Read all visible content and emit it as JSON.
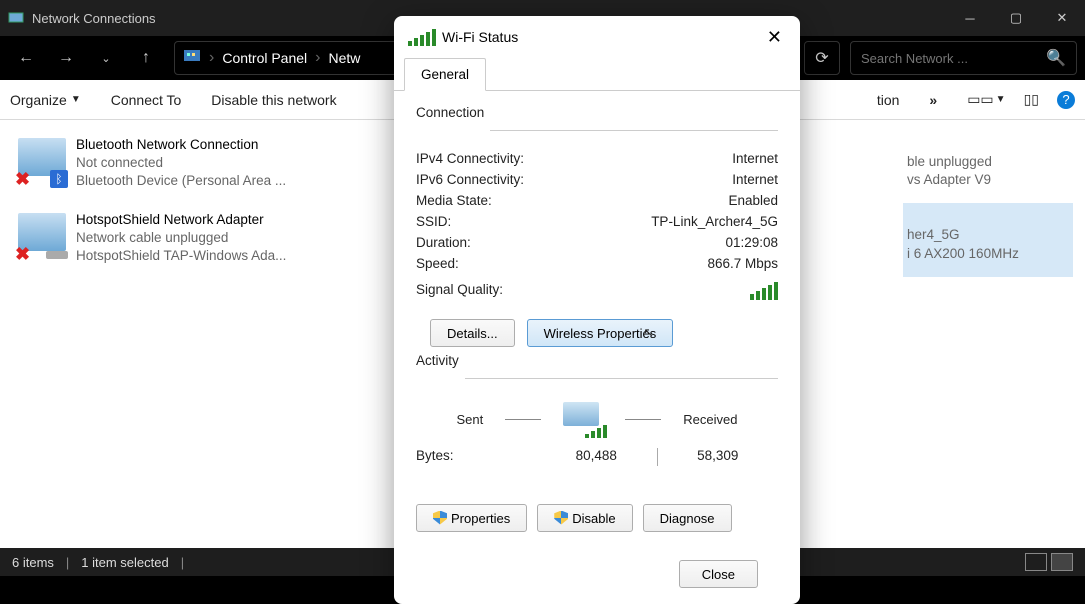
{
  "window": {
    "title": "Network Connections"
  },
  "nav": {
    "crumb1": "Control Panel",
    "crumb2": "Netw",
    "search_placeholder": "Search Network ..."
  },
  "toolbar": {
    "organize": "Organize",
    "connect": "Connect To",
    "disable": "Disable this network",
    "more_trunc": "tion"
  },
  "adapters": [
    {
      "name": "Bluetooth Network Connection",
      "status": "Not connected",
      "device": "Bluetooth Device (Personal Area ..."
    },
    {
      "name": "HotspotShield Network Adapter",
      "status": "Network cable unplugged",
      "device": "HotspotShield TAP-Windows Ada..."
    }
  ],
  "adapters_col2_cut": [
    {
      "status_cut": "ble unplugged",
      "device_cut": "vs Adapter V9"
    },
    {
      "status_cut": "her4_5G",
      "device_cut": "i 6 AX200 160MHz"
    }
  ],
  "statusbar": {
    "count": "6 items",
    "sel": "1 item selected",
    "divider": "|"
  },
  "dialog": {
    "title": "Wi-Fi Status",
    "tab": "General",
    "group_connection": "Connection",
    "ipv4_l": "IPv4 Connectivity:",
    "ipv4_v": "Internet",
    "ipv6_l": "IPv6 Connectivity:",
    "ipv6_v": "Internet",
    "media_l": "Media State:",
    "media_v": "Enabled",
    "ssid_l": "SSID:",
    "ssid_v": "TP-Link_Archer4_5G",
    "dur_l": "Duration:",
    "dur_v": "01:29:08",
    "speed_l": "Speed:",
    "speed_v": "866.7 Mbps",
    "sq_l": "Signal Quality:",
    "details": "Details...",
    "wprops": "Wireless Properties",
    "group_activity": "Activity",
    "sent": "Sent",
    "received": "Received",
    "bytes_l": "Bytes:",
    "bytes_sent": "80,488",
    "bytes_recv": "58,309",
    "btn_props": "Properties",
    "btn_disable": "Disable",
    "btn_diag": "Diagnose",
    "close": "Close"
  }
}
